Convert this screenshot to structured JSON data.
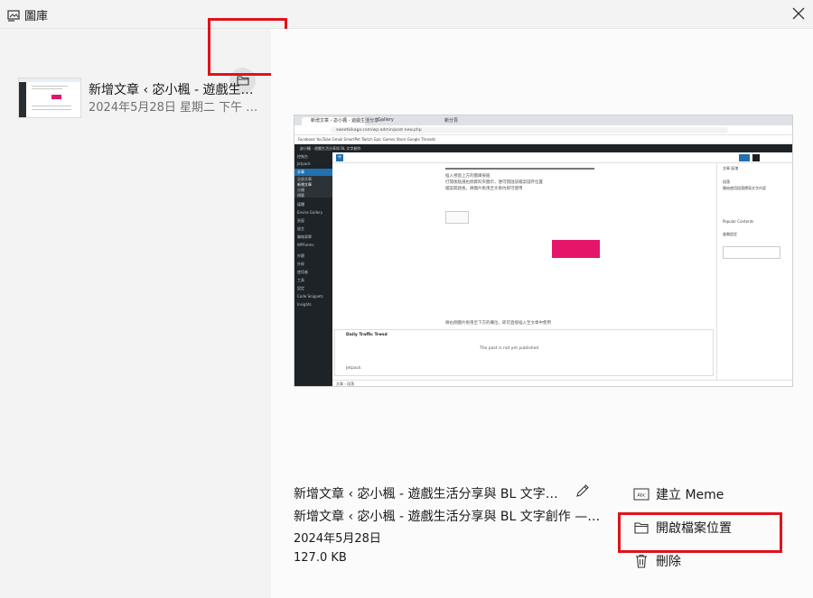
{
  "window": {
    "title": "圖庫",
    "close_icon": "close-icon"
  },
  "sidebar": {
    "folder_icon": "folder-icon",
    "items": [
      {
        "title": "新增文章 ‹ 宓小楓 - 遊戲生活分享與 BL 文字創作 — WordPress",
        "date": "2024年5月28日 星期二 下午 …"
      }
    ]
  },
  "preview": {
    "tabs": [
      "新增文章 ‹ 宓小楓 - 遊戲生活分享…",
      "Gallery",
      "新分頁"
    ],
    "url": "sweetkikago.com/wp-admin/post-new.php",
    "bookmarks": "Facebook  YouTube  Gmail  SmartPet  Twitch  Epic Games Store  Google  Threads",
    "admin_bar": "宓小楓 - 遊戲生活分享與 BL 文字創作",
    "side_items": [
      "控制台",
      "Jetpack",
      "文章",
      "全部文章",
      "新增文章",
      "分類",
      "標籤",
      "媒體",
      "Envira Gallery",
      "頁面",
      "留言",
      "聯絡表單",
      "WPForms",
      "外觀",
      "外掛",
      "使用者",
      "工具",
      "設定",
      "Code Snippets",
      "Insights"
    ],
    "content_lines": [
      "插入視窗上方的圖庫按鈕",
      "打開後點選右側資料夾圖示，便可開啟該檔案儲存位置",
      "檔案開啟後，將圖片拖曳至文章內即可使用"
    ],
    "caption": "將右側圖片拖曳至下方的欄位，即可直接插入至文章中使用",
    "card_title": "Daily Traffic Trend",
    "card_body": "The post is not yet published",
    "card_footer": "Jetpack",
    "right_tabs": "文章    區塊",
    "right_labels": [
      "段落",
      "開始使用段落撰寫文字內容",
      "Popular Contents",
      "進階設定"
    ],
    "footer": "文章  ›  段落"
  },
  "details": {
    "title": "新增文章 ‹ 宓小楓 - 遊戲生活分享與 BL 文字創作 — WordPress",
    "subtitle": "新增文章 ‹ 宓小楓 - 遊戲生活分享與 BL 文字創作 — WordPress",
    "date": "2024年5月28日",
    "size": "127.0 KB",
    "edit_icon": "pencil-icon"
  },
  "actions": {
    "create_meme": "建立 Meme",
    "open_file_location": "開啟檔案位置",
    "delete": "刪除"
  },
  "colors": {
    "highlight_red": "#e0121a",
    "wp_blue": "#2271b1",
    "accent_pink": "#e5166a"
  }
}
